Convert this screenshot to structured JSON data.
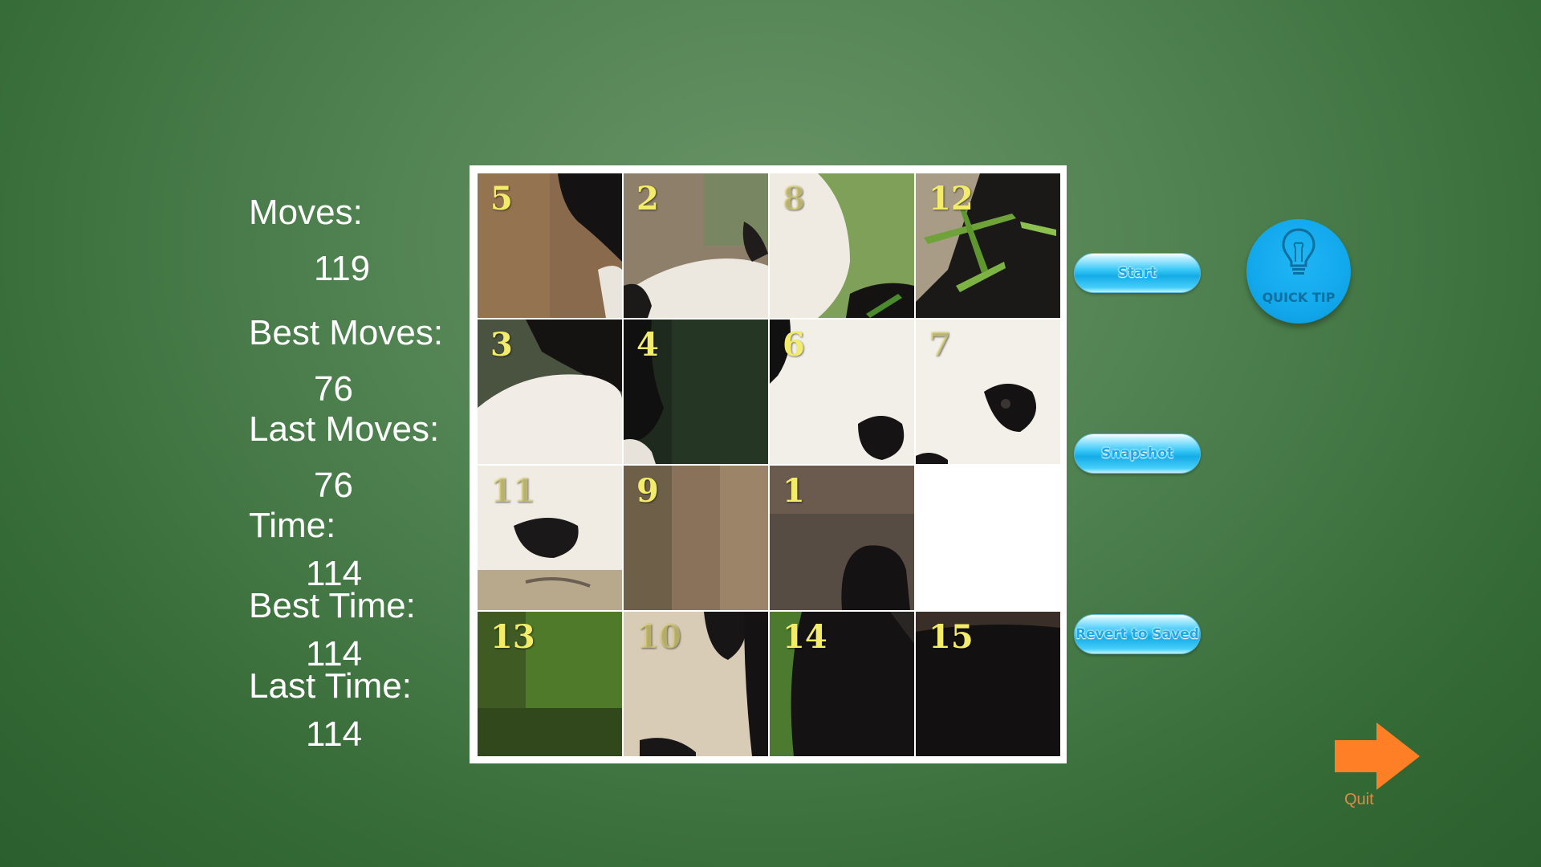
{
  "stats": {
    "moves_label": "Moves:",
    "moves_value": "119",
    "best_moves_label": "Best Moves:",
    "best_moves_value": "76",
    "last_moves_label": "Last Moves:",
    "last_moves_value": "76",
    "time_label": "Time:",
    "time_value": "114",
    "best_time_label": "Best Time:",
    "best_time_value": "114",
    "last_time_label": "Last Time:",
    "last_time_value": "114"
  },
  "board": {
    "tiles": [
      "5",
      "2",
      "8",
      "12",
      "3",
      "4",
      "6",
      "7",
      "11",
      "9",
      "1",
      "",
      "13",
      "10",
      "14",
      "15"
    ],
    "empty_index": 11
  },
  "buttons": {
    "start": "Start",
    "snapshot": "Snapshot",
    "revert": "Revert to Saved"
  },
  "quick_tip": {
    "label": "QUICK TIP",
    "icon": "lightbulb-icon"
  },
  "quit": {
    "label": "Quit",
    "icon": "arrow-right-icon",
    "color": "#ff7f27"
  }
}
